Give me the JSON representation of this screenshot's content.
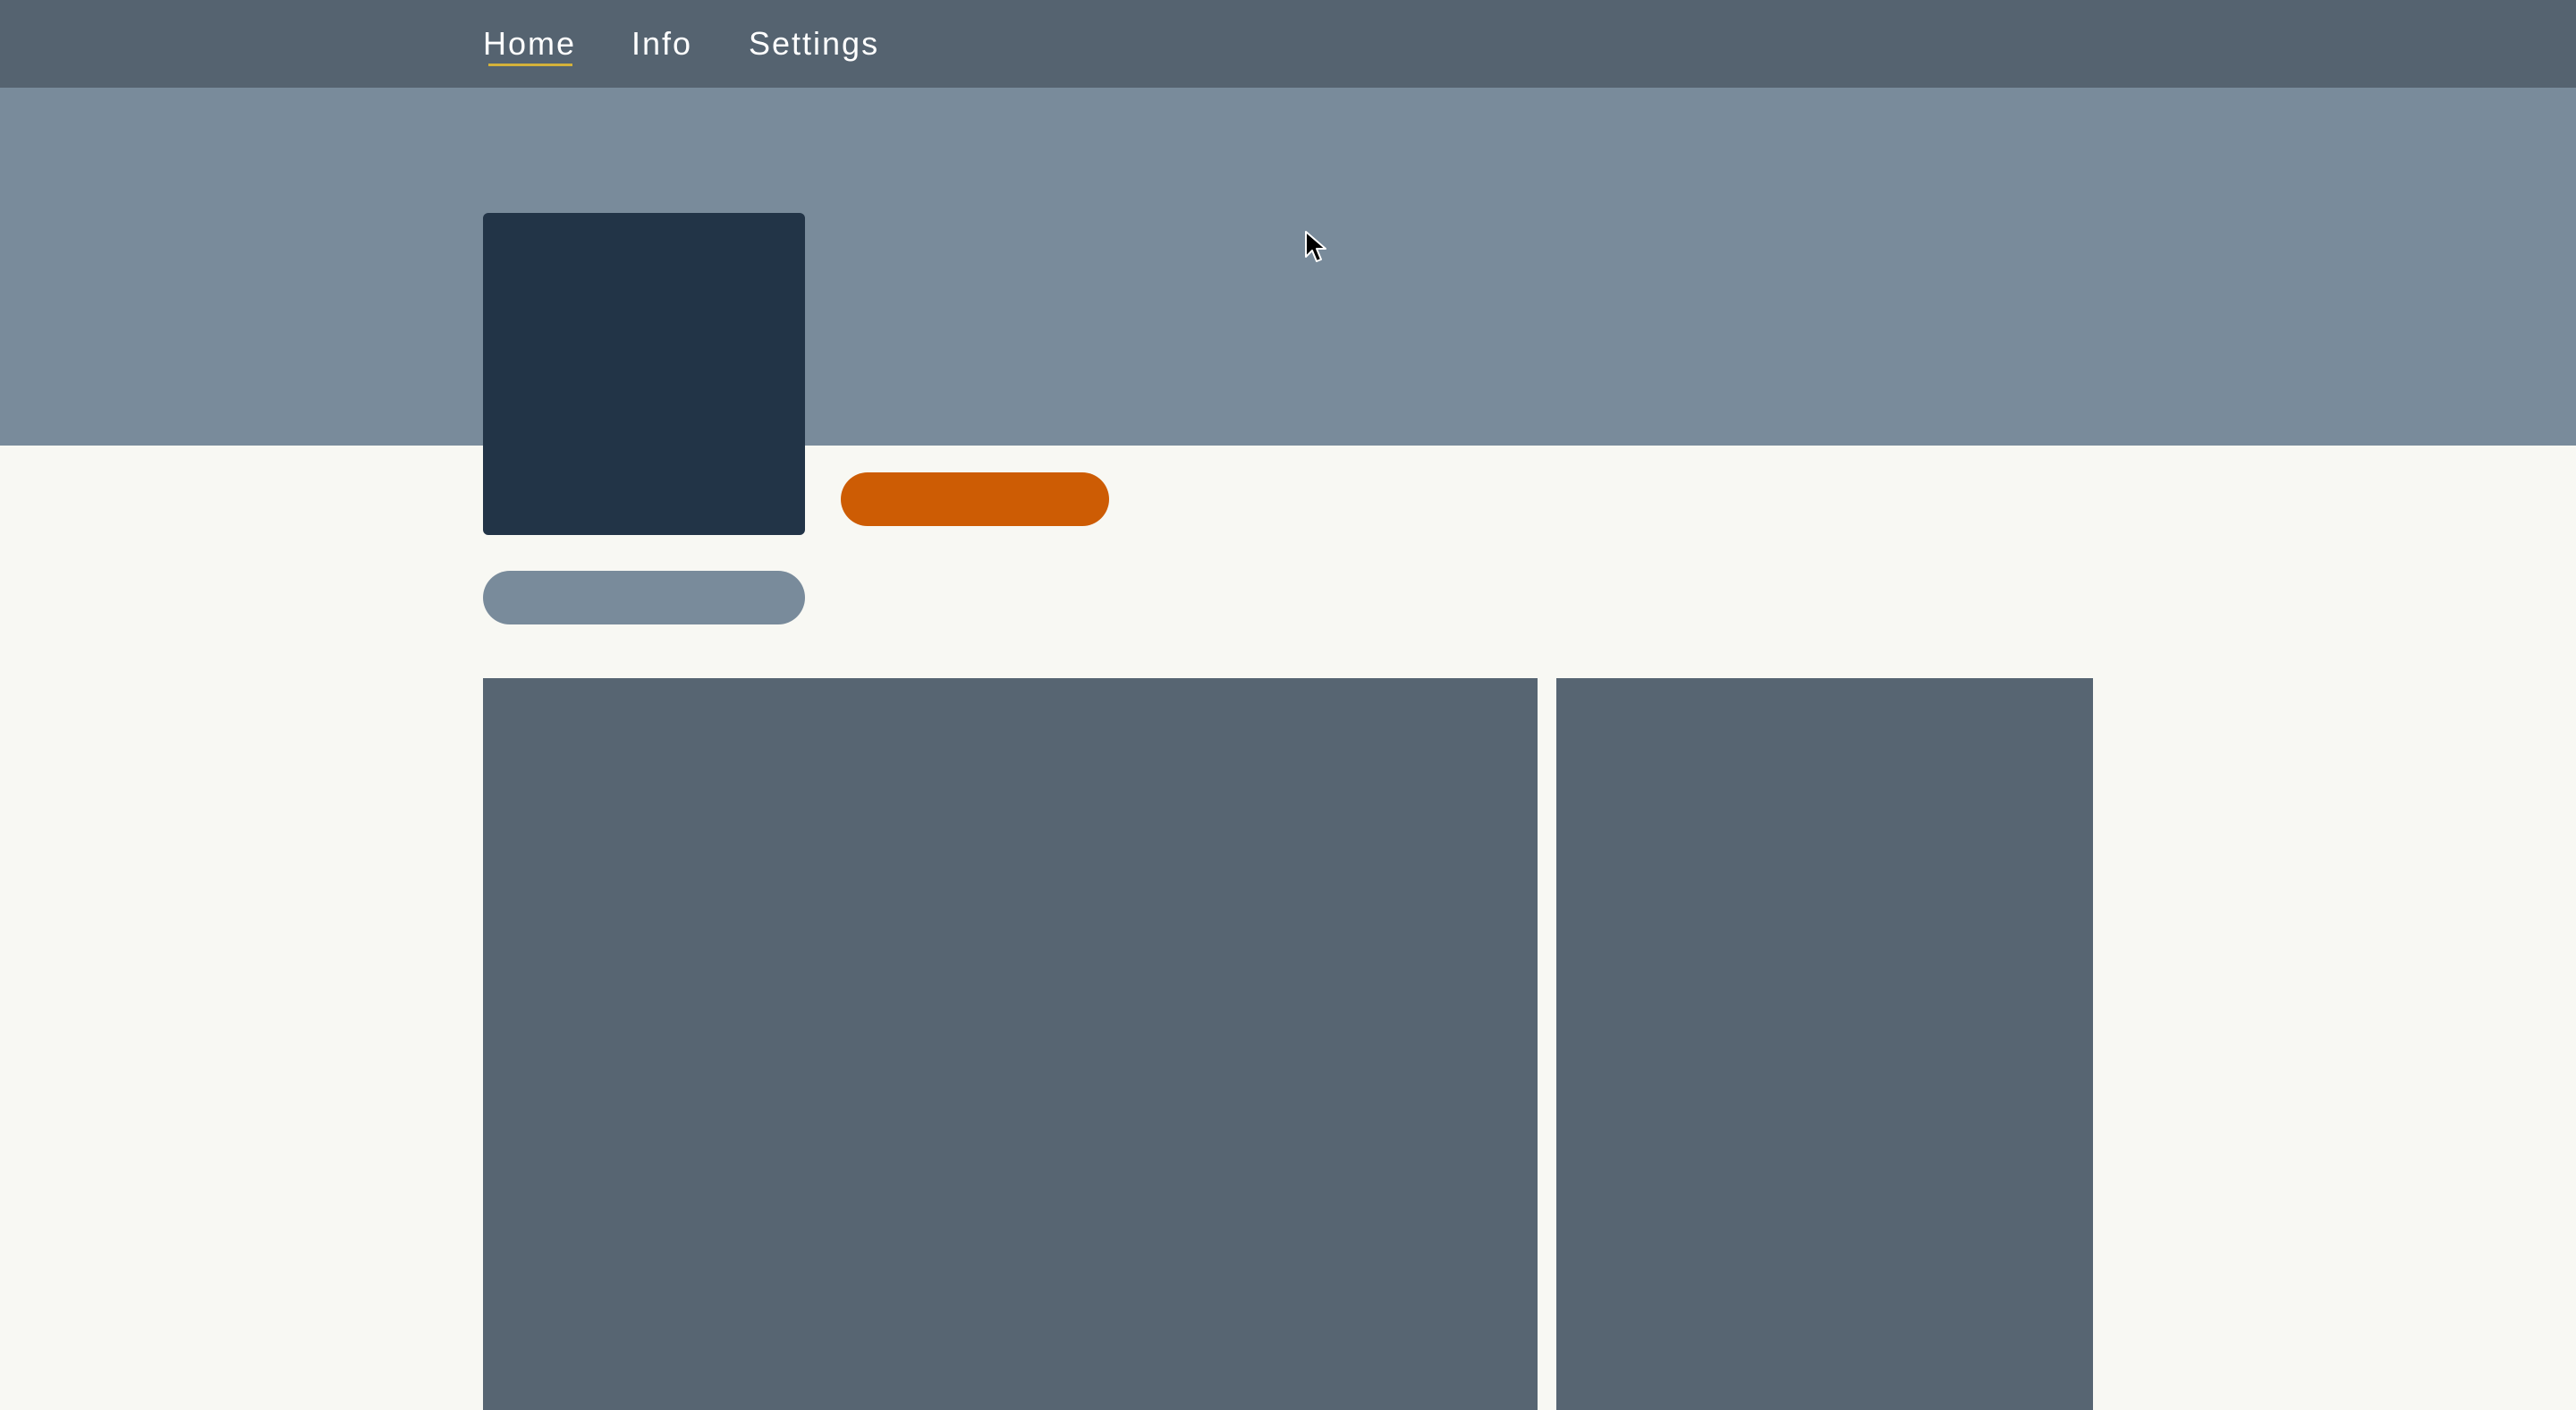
{
  "nav": {
    "items": [
      {
        "label": "Home",
        "active": true
      },
      {
        "label": "Info",
        "active": false
      },
      {
        "label": "Settings",
        "active": false
      }
    ]
  },
  "colors": {
    "navbar": "#556370",
    "banner": "#798b9b",
    "avatar": "#223447",
    "accent": "#cd5c04",
    "active_underline": "#d4b23a",
    "panel": "#576572",
    "page_bg": "#f8f8f3"
  },
  "icons": {
    "cursor": "mouse-pointer-icon"
  }
}
